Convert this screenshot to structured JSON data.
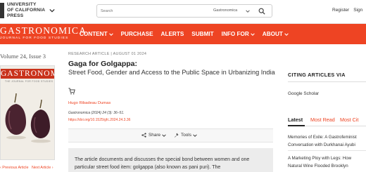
{
  "header": {
    "logo_line1": "UNIVERSITY",
    "logo_line2": "OF CALIFORNIA",
    "logo_line3": "PRESS",
    "search_placeholder": "Search",
    "search_scope": "Gastronomica",
    "links": [
      "Register",
      "Sign"
    ]
  },
  "nav": {
    "brand_title": "GASTRONOMICA",
    "brand_subtitle": "JOURNAL FOR FOOD STUDIES",
    "items": [
      {
        "label": "CONTENT",
        "has_menu": true
      },
      {
        "label": "PURCHASE",
        "has_menu": false
      },
      {
        "label": "ALERTS",
        "has_menu": false
      },
      {
        "label": "SUBMIT",
        "has_menu": false
      },
      {
        "label": "INFO FOR",
        "has_menu": true
      },
      {
        "label": "ABOUT",
        "has_menu": true
      }
    ],
    "accent_color": "#ee4423"
  },
  "sidebar_left": {
    "issue_label": "Volume 24, Issue 3",
    "cover_title": "GASTRONOMICA",
    "cover_subtitle": "THE JOURNAL FOR FOOD STUDIES",
    "previous_label": "‹ Previous Article",
    "next_label": "Next Article ›"
  },
  "article": {
    "meta": "RESEARCH ARTICLE  |   AUGUST 01 2024",
    "title": "Gaga for Golgappa:",
    "subtitle": "Street Food, Gender and Access to the Public Space in Urbanizing India",
    "author": "Hugo Ribadeau Dumas",
    "citation": "Gastronomica (2024) 24 (3): 36–51.",
    "doi": "https://doi.org/10.1525/gfc.2024.24.3.36",
    "share_label": "Share",
    "tools_label": "Tools",
    "abstract": "The article documents and discusses the special bond between women and one particular street food item: golgappa (also known as pani puri). The"
  },
  "sidebar_right": {
    "citing_heading": "CITING ARTICLES VIA",
    "google_scholar": "Google Scholar",
    "tabs": [
      "Latest",
      "Most Read",
      "Most Cit"
    ],
    "active_tab": 0,
    "items": [
      {
        "line1": "Memories of Exile: A Gastrofeminist",
        "line2": "Conversation with Durkhanai Ayubi"
      },
      {
        "line1": "A Marketing Ploy with Legs: How",
        "line2": "Natural Wine Flooded Brooklyn"
      }
    ]
  }
}
